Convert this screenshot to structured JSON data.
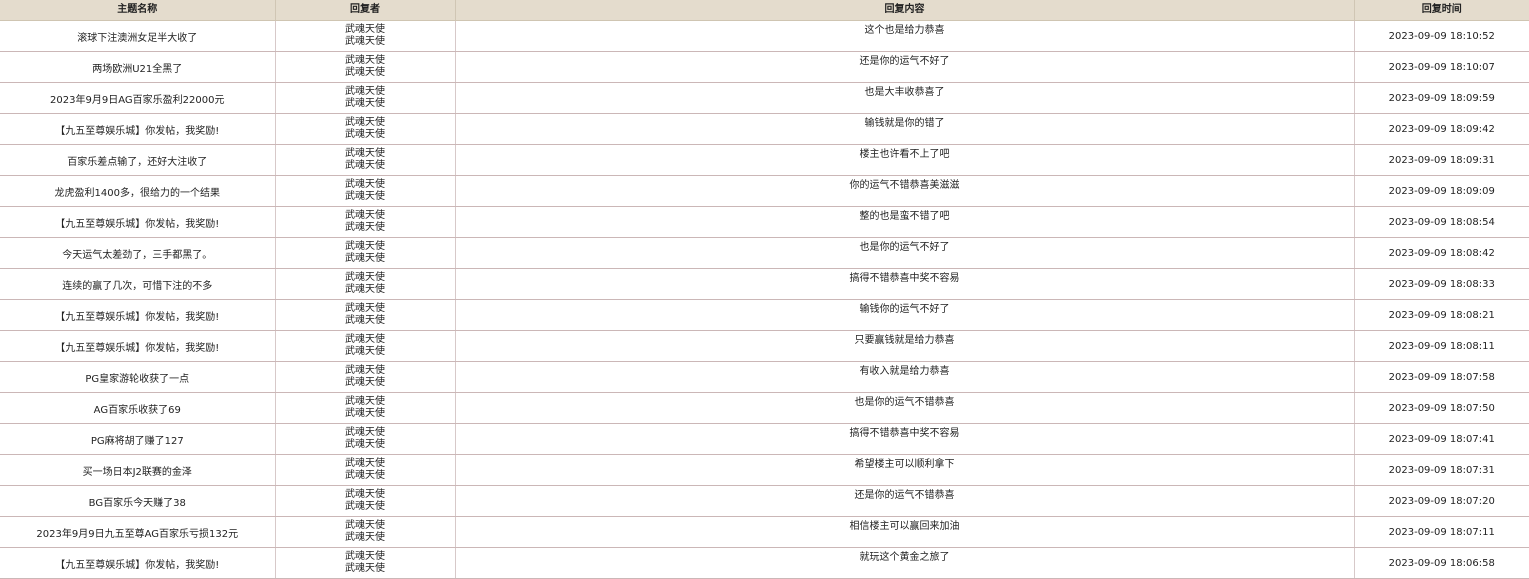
{
  "table": {
    "headers": {
      "topic": "主题名称",
      "replier": "回复者",
      "content": "回复内容",
      "time": "回复时间"
    },
    "rows": [
      {
        "topic": "滚球下注澳洲女足半大收了",
        "replier": [
          "武魂天使",
          "武魂天使"
        ],
        "content": "这个也是给力恭喜",
        "time": "2023-09-09 18:10:52"
      },
      {
        "topic": "两场欧洲U21全黑了",
        "replier": [
          "武魂天使",
          "武魂天使"
        ],
        "content": "还是你的运气不好了",
        "time": "2023-09-09 18:10:07"
      },
      {
        "topic": "2023年9月9日AG百家乐盈利22000元",
        "replier": [
          "武魂天使",
          "武魂天使"
        ],
        "content": "也是大丰收恭喜了",
        "time": "2023-09-09 18:09:59"
      },
      {
        "topic": "【九五至尊娱乐城】你发帖，我奖励!",
        "replier": [
          "武魂天使",
          "武魂天使"
        ],
        "content": "输钱就是你的错了",
        "time": "2023-09-09 18:09:42"
      },
      {
        "topic": "百家乐差点输了，还好大注收了",
        "replier": [
          "武魂天使",
          "武魂天使"
        ],
        "content": "楼主也许看不上了吧",
        "time": "2023-09-09 18:09:31"
      },
      {
        "topic": "龙虎盈利1400多，很给力的一个结果",
        "replier": [
          "武魂天使",
          "武魂天使"
        ],
        "content": "你的运气不错恭喜美滋滋",
        "time": "2023-09-09 18:09:09"
      },
      {
        "topic": "【九五至尊娱乐城】你发帖，我奖励!",
        "replier": [
          "武魂天使",
          "武魂天使"
        ],
        "content": "整的也是蛮不错了吧",
        "time": "2023-09-09 18:08:54"
      },
      {
        "topic": "今天运气太差劲了，三手都黑了。",
        "replier": [
          "武魂天使",
          "武魂天使"
        ],
        "content": "也是你的运气不好了",
        "time": "2023-09-09 18:08:42"
      },
      {
        "topic": "连续的赢了几次，可惜下注的不多",
        "replier": [
          "武魂天使",
          "武魂天使"
        ],
        "content": "搞得不错恭喜中奖不容易",
        "time": "2023-09-09 18:08:33"
      },
      {
        "topic": "【九五至尊娱乐城】你发帖，我奖励!",
        "replier": [
          "武魂天使",
          "武魂天使"
        ],
        "content": "输钱你的运气不好了",
        "time": "2023-09-09 18:08:21"
      },
      {
        "topic": "【九五至尊娱乐城】你发帖，我奖励!",
        "replier": [
          "武魂天使",
          "武魂天使"
        ],
        "content": "只要赢钱就是给力恭喜",
        "time": "2023-09-09 18:08:11"
      },
      {
        "topic": "PG皇家游轮收获了一点",
        "replier": [
          "武魂天使",
          "武魂天使"
        ],
        "content": "有收入就是给力恭喜",
        "time": "2023-09-09 18:07:58"
      },
      {
        "topic": "AG百家乐收获了69",
        "replier": [
          "武魂天使",
          "武魂天使"
        ],
        "content": "也是你的运气不错恭喜",
        "time": "2023-09-09 18:07:50"
      },
      {
        "topic": "PG麻将胡了赚了127",
        "replier": [
          "武魂天使",
          "武魂天使"
        ],
        "content": "搞得不错恭喜中奖不容易",
        "time": "2023-09-09 18:07:41"
      },
      {
        "topic": "买一场日本J2联赛的金泽",
        "replier": [
          "武魂天使",
          "武魂天使"
        ],
        "content": "希望楼主可以顺利拿下",
        "time": "2023-09-09 18:07:31"
      },
      {
        "topic": "BG百家乐今天赚了38",
        "replier": [
          "武魂天使",
          "武魂天使"
        ],
        "content": "还是你的运气不错恭喜",
        "time": "2023-09-09 18:07:20"
      },
      {
        "topic": "2023年9月9日九五至尊AG百家乐亏损132元",
        "replier": [
          "武魂天使",
          "武魂天使"
        ],
        "content": "相信楼主可以赢回来加油",
        "time": "2023-09-09 18:07:11"
      },
      {
        "topic": "【九五至尊娱乐城】你发帖，我奖励!",
        "replier": [
          "武魂天使",
          "武魂天使"
        ],
        "content": "就玩这个黄金之旅了",
        "time": "2023-09-09 18:06:58"
      }
    ]
  }
}
